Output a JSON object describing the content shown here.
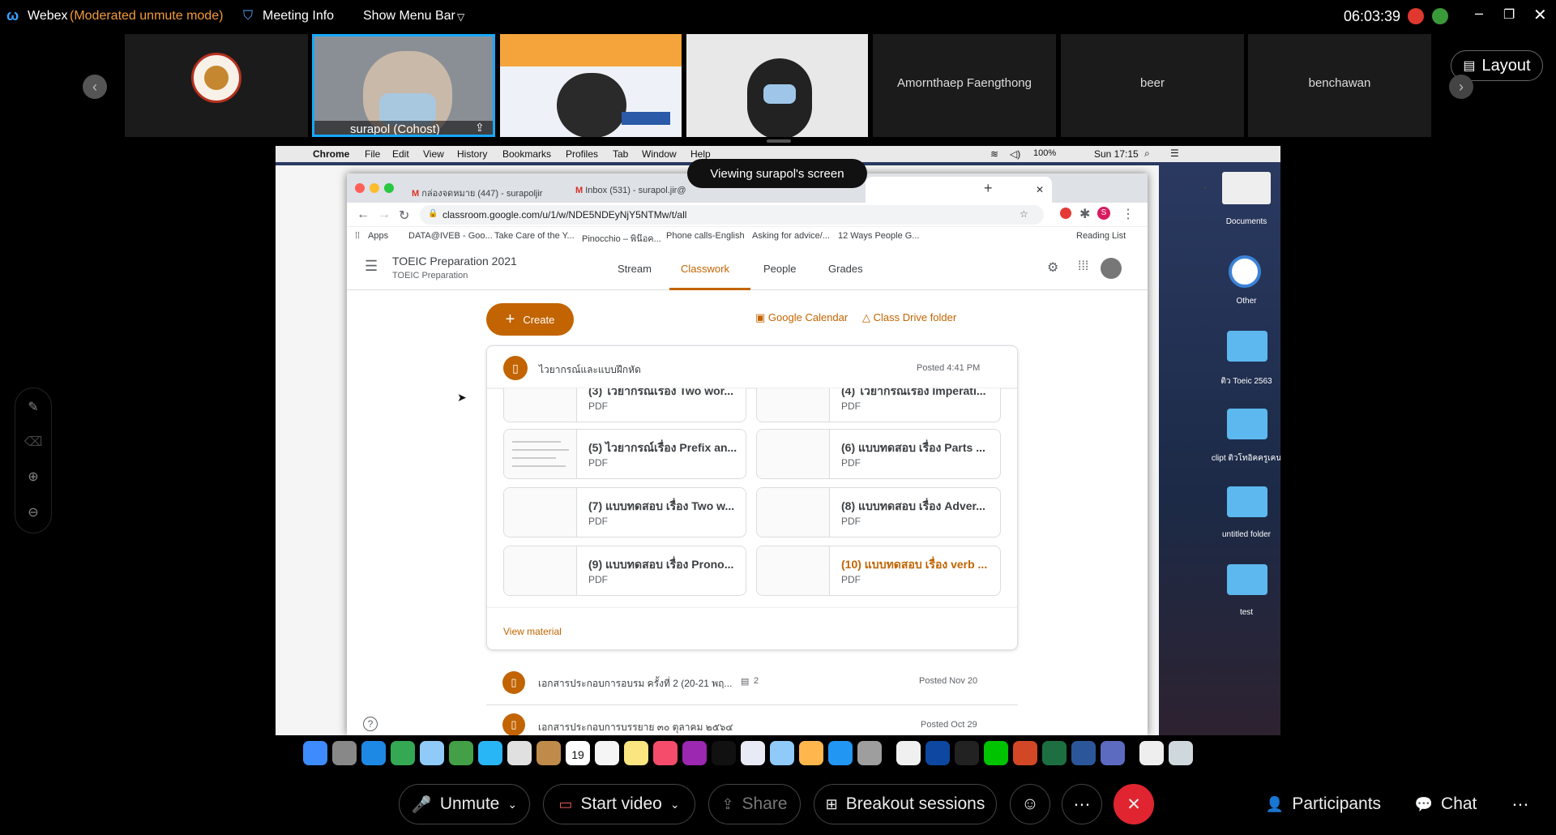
{
  "titlebar": {
    "app": "Webex",
    "mode": "(Moderated unmute mode)",
    "meeting_info": "Meeting Info",
    "show_menu_bar": "Show Menu Bar",
    "clock": "06:03:39"
  },
  "participants_strip": {
    "tiles": [
      {
        "name": "surapol  (Cohost)"
      },
      {
        "name": ""
      },
      {
        "name": ""
      },
      {
        "name": "Amornthaep Faengthong"
      },
      {
        "name": "beer"
      },
      {
        "name": "benchawan"
      }
    ],
    "layout_label": "Layout"
  },
  "share": {
    "toast": "Viewing surapol's screen",
    "mac_menu": [
      "Chrome",
      "File",
      "Edit",
      "View",
      "History",
      "Bookmarks",
      "Profiles",
      "Tab",
      "Window",
      "Help"
    ],
    "mac_status": {
      "battery": "100%",
      "time": "Sun 17:15"
    },
    "tabs": [
      {
        "label": "กล่องจดหมาย (447) - surapoljir"
      },
      {
        "label": "Inbox (531) - surapol.jir@"
      }
    ],
    "url": "classroom.google.com/u/1/w/NDE5NDEyNjY5NTMw/t/all",
    "bookmarks": [
      "Apps",
      "DATA@IVEB - Goo...",
      "Take Care of the Y...",
      "Pinocchio – พิน๊อค...",
      "Phone calls-English",
      "Asking for advice/...",
      "12 Ways People G..."
    ],
    "reading_list": "Reading List",
    "classroom": {
      "title": "TOEIC Preparation 2021",
      "subtitle": "TOEIC Preparation",
      "tabs": [
        "Stream",
        "Classwork",
        "People",
        "Grades"
      ],
      "create": "Create",
      "google_calendar": "Google Calendar",
      "class_drive": "Class Drive folder",
      "topic": {
        "title": "ไวยากรณ์และแบบฝึกหัด",
        "posted": "Posted 4:41 PM"
      },
      "materials": [
        {
          "title": "(3) ไวยากรณ์เรื่อง Two wor...",
          "type": "PDF"
        },
        {
          "title": "(4) ไวยากรณ์เรื่อง Imperati...",
          "type": "PDF"
        },
        {
          "title": "(5) ไวยากรณ์เรื่อง Prefix an...",
          "type": "PDF"
        },
        {
          "title": "(6) แบบทดสอบ เรื่อง Parts ...",
          "type": "PDF"
        },
        {
          "title": "(7) แบบทดสอบ เรื่อง Two w...",
          "type": "PDF"
        },
        {
          "title": "(8) แบบทดสอบ เรื่อง Adver...",
          "type": "PDF"
        },
        {
          "title": "(9) แบบทดสอบ เรื่อง Prono...",
          "type": "PDF"
        },
        {
          "title": "(10) แบบทดสอบ เรื่อง verb ...",
          "type": "PDF"
        }
      ],
      "view_material": "View material",
      "other_posts": [
        {
          "title": "เอกสารประกอบการอบรม ครั้งที่ 2 (20-21 พฤ...",
          "comments": "2",
          "posted": "Posted Nov 20"
        },
        {
          "title": "เอกสารประกอบการบรรยาย ๓๐ ตุลาคม ๒๕๖๔",
          "comments": "",
          "posted": "Posted Oct 29"
        }
      ]
    },
    "desktop": [
      "Documents",
      "Other",
      "ติว Toeic 2563",
      "clipt ติวโทอิคครูเคน",
      "untitled folder",
      "test"
    ],
    "dock_date": "19"
  },
  "bottombar": {
    "unmute": "Unmute",
    "start_video": "Start video",
    "share": "Share",
    "breakout": "Breakout sessions",
    "participants": "Participants",
    "chat": "Chat"
  },
  "colors": {
    "classroom_accent": "#c26401",
    "webex_active": "#2fa0ff",
    "end_red": "#e02530"
  }
}
